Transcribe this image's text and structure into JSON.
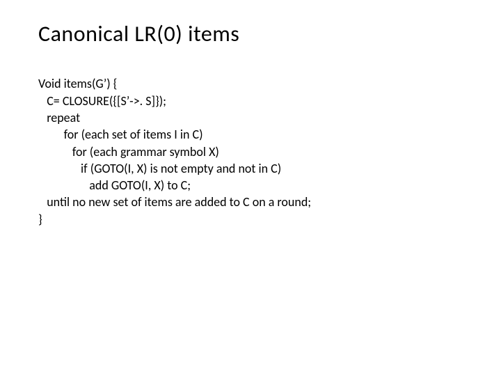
{
  "slide": {
    "title": "Canonical LR(0) items",
    "code": {
      "l1": "Void items(G’) {",
      "l2": "   C= CLOSURE({[S’->. S]});",
      "l3": "   repeat",
      "l4": "         for (each set of items I in C)",
      "l5": "            for (each grammar symbol X)",
      "l6": "               if (GOTO(I, X) is not empty and not in C)",
      "l7": "                  add GOTO(I, X) to C;",
      "l8": "   until no new set of items are added to C on a round;",
      "l9": "}"
    }
  }
}
